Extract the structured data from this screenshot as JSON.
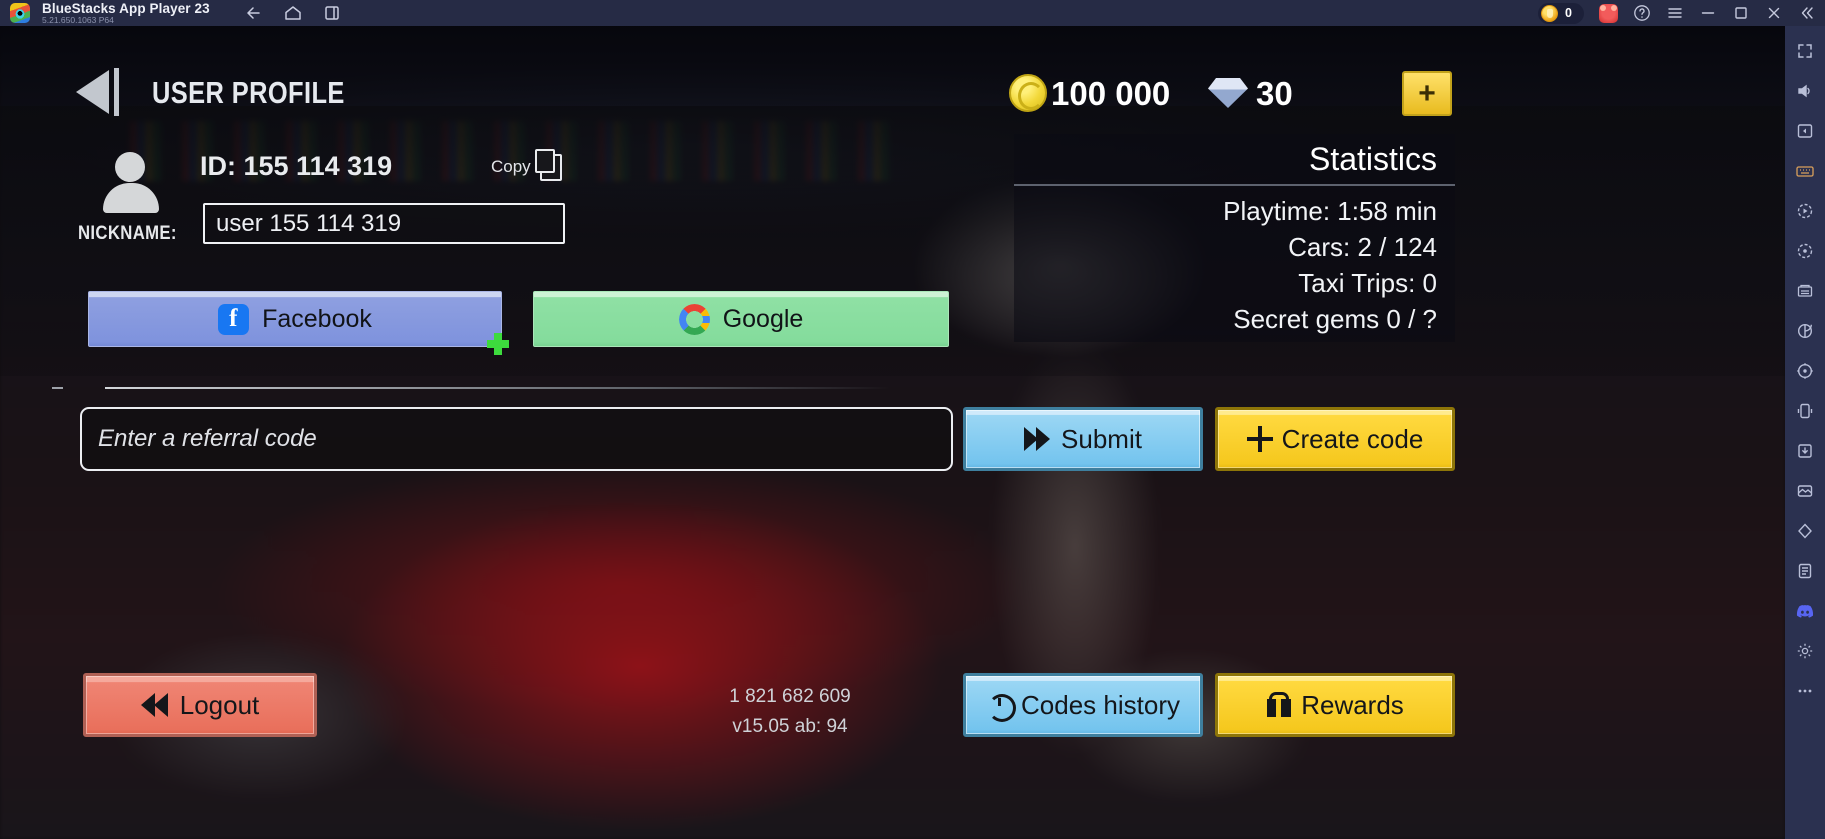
{
  "titlebar": {
    "app_title": "BlueStacks App Player 23",
    "app_version": "5.21.650.1063  P64",
    "nav": [
      {
        "name": "back-icon",
        "glyph": "←"
      },
      {
        "name": "home-icon",
        "glyph": "⌂"
      },
      {
        "name": "multi-instance-icon",
        "glyph": "▤"
      }
    ],
    "coin_count": "0",
    "right_icons": [
      {
        "name": "bear-mascot-icon",
        "glyph": ""
      },
      {
        "name": "help-icon",
        "glyph": "?"
      },
      {
        "name": "menu-icon",
        "glyph": "☰"
      },
      {
        "name": "minimize-icon",
        "glyph": "—"
      },
      {
        "name": "maximize-icon",
        "glyph": "▢"
      },
      {
        "name": "close-icon",
        "glyph": "✕"
      },
      {
        "name": "collapse-sidebar-icon",
        "glyph": "«"
      }
    ]
  },
  "sidebar": {
    "items": [
      {
        "name": "fullscreen-icon",
        "glyph": "⤢"
      },
      {
        "name": "volume-icon",
        "glyph": "🔊"
      },
      {
        "name": "screenshot-icon",
        "glyph": "▣"
      },
      {
        "name": "keymapping-icon",
        "glyph": "⌨"
      },
      {
        "name": "macro-recorder-icon",
        "glyph": "◉"
      },
      {
        "name": "rotate-icon",
        "glyph": "⟳"
      },
      {
        "name": "multi-instance-manager-icon",
        "glyph": "▥"
      },
      {
        "name": "eco-mode-icon",
        "glyph": "◑"
      },
      {
        "name": "location-icon",
        "glyph": "◎"
      },
      {
        "name": "shake-icon",
        "glyph": "⬚"
      },
      {
        "name": "install-apk-icon",
        "glyph": "⬓"
      },
      {
        "name": "media-manager-icon",
        "glyph": "⬔"
      },
      {
        "name": "game-guide-icon",
        "glyph": "◈"
      },
      {
        "name": "script-icon",
        "glyph": "⬗"
      },
      {
        "name": "discord-icon",
        "glyph": "◍"
      },
      {
        "name": "settings-icon",
        "glyph": "⚙"
      },
      {
        "name": "more-icon",
        "glyph": "⋯"
      }
    ]
  },
  "header": {
    "back_label": "",
    "page_title": "USER PROFILE",
    "coins": "100 000",
    "gems": "30",
    "add_label": "+"
  },
  "profile": {
    "id_label": "ID: 155 114 319",
    "copy_label": "Copy",
    "nickname_label": "NICKNAME:",
    "nickname_value": "user 155 114 319",
    "nickname_placeholder": "user 155 114 319"
  },
  "social": {
    "facebook_label": "Facebook",
    "google_label": "Google"
  },
  "referral": {
    "placeholder": "Enter a referral code",
    "value": "",
    "submit_label": "Submit",
    "create_label": "Create code"
  },
  "statistics": {
    "title": "Statistics",
    "rows": [
      "Playtime: 1:58 min",
      "Cars: 2 / 124",
      "Taxi Trips: 0",
      "Secret gems 0 / ?"
    ]
  },
  "footer": {
    "logout_label": "Logout",
    "codes_history_label": "Codes history",
    "rewards_label": "Rewards",
    "build_number": "1 821 682 609",
    "version": "v15.05 ab: 94"
  },
  "colors": {
    "titlebar_bg": "#262b45",
    "sidebar_bg": "#2b3150",
    "accent_yellow": "#ffd93f",
    "accent_blue": "#9ad6f4",
    "accent_red": "#ef8473",
    "facebook_blue": "#1877f2"
  }
}
